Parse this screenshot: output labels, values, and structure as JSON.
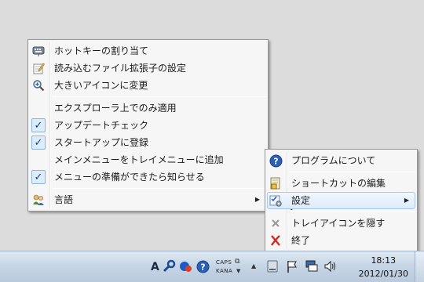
{
  "context_menu": {
    "items": [
      {
        "label": "ホットキーの割り当て",
        "icon": "keyboard-icon"
      },
      {
        "label": "読み込むファイル拡張子の設定",
        "icon": "edit-note-icon"
      },
      {
        "label": "大きいアイコンに変更",
        "icon": "magnifier-icon"
      },
      {
        "label": "エクスプローラ上でのみ適用",
        "checked": false
      },
      {
        "label": "アップデートチェック",
        "checked": true
      },
      {
        "label": "スタートアップに登録",
        "checked": true
      },
      {
        "label": "メインメニューをトレイメニューに追加",
        "checked": false
      },
      {
        "label": "メニューの準備ができたら知らせる",
        "checked": true
      },
      {
        "label": "言語",
        "icon": "language-people-icon",
        "submenu": true
      }
    ]
  },
  "tray_menu": {
    "items": [
      {
        "label": "プログラムについて",
        "icon": "help-icon"
      },
      {
        "label": "ショートカットの編集",
        "icon": "shortcut-edit-icon"
      },
      {
        "label": "設定",
        "icon": "settings-icon",
        "submenu": true,
        "highlighted": true
      },
      {
        "label": "トレイアイコンを隠す",
        "icon": "hide-icon"
      },
      {
        "label": "終了",
        "icon": "exit-icon"
      }
    ]
  },
  "taskbar": {
    "ime_mode": "A",
    "caps": "CAPS",
    "kana": "KANA",
    "time": "18:13",
    "date": "2012/01/30"
  },
  "colors": {
    "checkmark": "#1c3e78",
    "highlight_border": "#a8c7ec",
    "exit_red": "#d32b1f",
    "help_blue": "#2a5fb8"
  }
}
